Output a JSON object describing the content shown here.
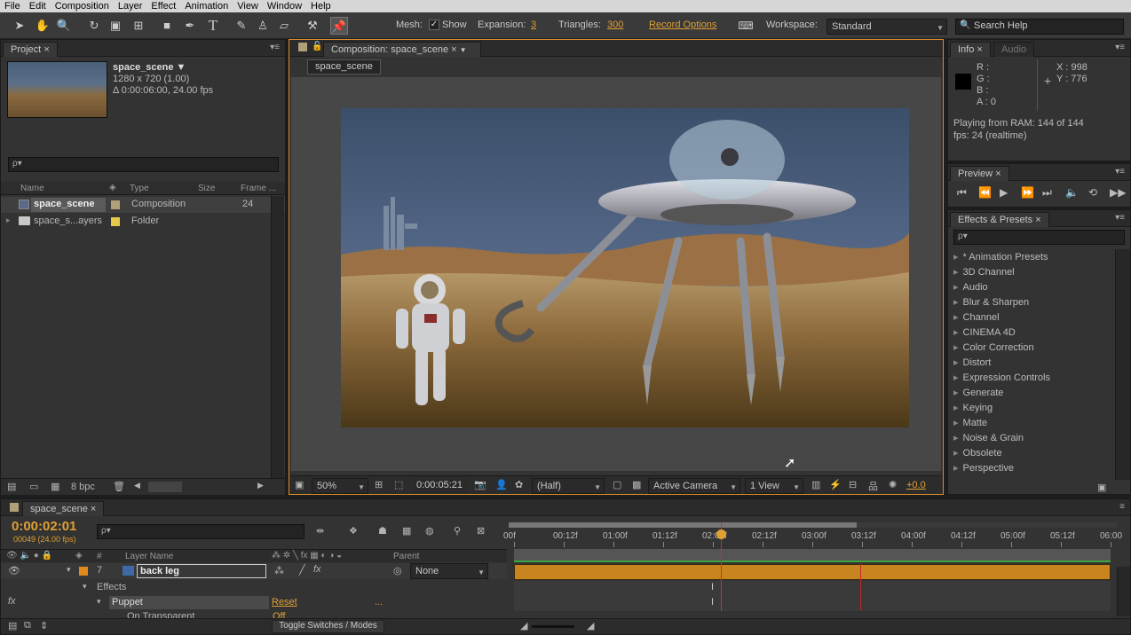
{
  "menu": [
    "File",
    "Edit",
    "Composition",
    "Layer",
    "Effect",
    "Animation",
    "View",
    "Window",
    "Help"
  ],
  "toolbar": {
    "mesh_label": "Mesh:",
    "show_label": "Show",
    "expansion_label": "Expansion:",
    "expansion_value": "3",
    "triangles_label": "Triangles:",
    "triangles_value": "300",
    "record_options": "Record Options",
    "workspace_label": "Workspace:",
    "workspace_value": "Standard",
    "search_placeholder": "Search Help"
  },
  "project": {
    "tab": "Project",
    "comp_name": "space_scene ▼",
    "comp_size": "1280 x 720 (1.00)",
    "comp_duration": "Δ 0:00:06:00, 24.00 fps",
    "search_placeholder": "ρ▾",
    "columns": {
      "name": "Name",
      "type": "Type",
      "size": "Size",
      "frame": "Frame ..."
    },
    "items": [
      {
        "name": "space_scene",
        "type": "Composition",
        "frame": "24",
        "color": "#b0a07a"
      },
      {
        "name": "space_s...ayers",
        "type": "Folder",
        "frame": "",
        "color": "#e6c84a"
      }
    ],
    "bpc": "8 bpc"
  },
  "composition": {
    "tab": "Composition: space_scene",
    "sub_tab": "space_scene",
    "zoom": "50%",
    "timecode": "0:00:05:21",
    "resolution": "(Half)",
    "camera": "Active Camera",
    "views": "1 View",
    "exposure": "+0.0"
  },
  "info": {
    "tab": "Info",
    "tab2": "Audio",
    "r": "R :",
    "g": "G :",
    "b": "B :",
    "a": "A : 0",
    "x": "X : 998",
    "y": "Y : 776",
    "playing": "Playing from RAM: 144 of 144",
    "fps": "fps: 24 (realtime)"
  },
  "preview": {
    "tab": "Preview"
  },
  "effects": {
    "tab": "Effects & Presets",
    "search_placeholder": "ρ▾",
    "items": [
      "* Animation Presets",
      "3D Channel",
      "Audio",
      "Blur & Sharpen",
      "Channel",
      "CINEMA 4D",
      "Color Correction",
      "Distort",
      "Expression Controls",
      "Generate",
      "Keying",
      "Matte",
      "Noise & Grain",
      "Obsolete",
      "Perspective"
    ]
  },
  "timeline": {
    "tab": "space_scene",
    "timecode": "0:00:02:01",
    "frame_info": "00049 (24.00 fps)",
    "search_placeholder": "ρ▾",
    "ruler": [
      "00f",
      "00:12f",
      "01:00f",
      "01:12f",
      "02:00f",
      "02:12f",
      "03:00f",
      "03:12f",
      "04:00f",
      "04:12f",
      "05:00f",
      "05:12f",
      "06:00"
    ],
    "col_layer_name": "Layer Name",
    "col_hash": "#",
    "col_parent": "Parent",
    "layer_num": "7",
    "layer_name": "back leg",
    "parent_value": "None",
    "effects_label": "Effects",
    "puppet_label": "Puppet",
    "reset_label": "Reset",
    "ellipsis": "...",
    "on_transparent": "On Transparent",
    "off_value": "Off",
    "toggle_label": "Toggle Switches / Modes",
    "playhead_fraction": 0.3472,
    "work_area_end_fraction": 0.5833
  },
  "colors": {
    "accent": "#e0a033",
    "layer_bar": "#c8841e",
    "green_bar": "#3fa53f",
    "playhead": "#d03030"
  }
}
